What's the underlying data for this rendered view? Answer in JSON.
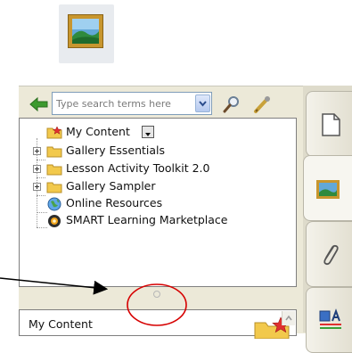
{
  "search": {
    "placeholder": "Type search terms here"
  },
  "tree": {
    "items": [
      {
        "label": "My Content",
        "icon": "my-content-folder-icon"
      },
      {
        "label": "Gallery Essentials",
        "icon": "folder-icon"
      },
      {
        "label": "Lesson Activity Toolkit 2.0",
        "icon": "folder-icon"
      },
      {
        "label": "Gallery Sampler",
        "icon": "folder-icon"
      },
      {
        "label": "Online Resources",
        "icon": "globe-icon"
      },
      {
        "label": "SMART Learning Marketplace",
        "icon": "marketplace-icon"
      }
    ]
  },
  "bottom_pane": {
    "label": "My Content"
  },
  "side_tabs": [
    {
      "name": "page-sorter",
      "icon": "page-icon"
    },
    {
      "name": "gallery",
      "icon": "picture-icon"
    },
    {
      "name": "attachments",
      "icon": "paperclip-icon"
    },
    {
      "name": "properties",
      "icon": "properties-icon"
    }
  ],
  "colors": {
    "panel_bg": "#ece9d8",
    "tree_bg": "#ffffff",
    "annotation_red": "#d60000",
    "arrow": "#000000",
    "folder_yellow": "#f2c94c",
    "frame_gold": "#c8962e"
  }
}
